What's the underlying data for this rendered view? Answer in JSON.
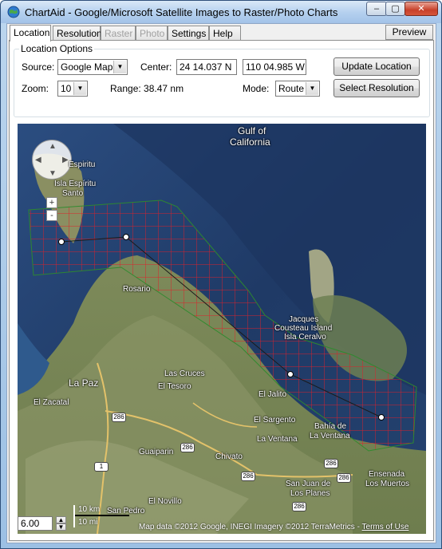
{
  "window": {
    "title": "ChartAid - Google/Microsoft Satellite Images to Raster/Photo Charts",
    "icon": "globe-icon",
    "controls": {
      "minimize": "‒",
      "maximize": "▢",
      "close": "✕"
    }
  },
  "tabs": [
    {
      "label": "Location",
      "state": "active"
    },
    {
      "label": "Resolution",
      "state": "normal"
    },
    {
      "label": "Raster",
      "state": "disabled"
    },
    {
      "label": "Photo",
      "state": "disabled"
    },
    {
      "label": "Settings",
      "state": "normal"
    },
    {
      "label": "Help",
      "state": "normal"
    }
  ],
  "preview_label": "Preview",
  "location_options": {
    "group_title": "Location Options",
    "source_label": "Source:",
    "source_value": "Google Maps",
    "center_label": "Center:",
    "center_lat": "24 14.037 N",
    "center_lon": "110 04.985 W",
    "update_button": "Update Location",
    "zoom_label": "Zoom:",
    "zoom_value": "10",
    "range_text": "Range: 38.47 nm",
    "mode_label": "Mode:",
    "mode_value": "Route",
    "select_resolution_button": "Select Resolution"
  },
  "map": {
    "places": {
      "gulf": "Gulf of",
      "california": "California",
      "espiritu": "Espiritu",
      "isla_espiritu": "Isla Espíritu",
      "santo": "Santo",
      "rosario": "Rosario",
      "jacques": "Jacques",
      "cousteau": "Cousteau Island",
      "isla_ceralvo": "Isla Ceralvo",
      "la_paz": "La Paz",
      "el_zacatal": "El Zacatal",
      "las_cruces": "Las Cruces",
      "el_tesoro": "El Tesoro",
      "el_jalito": "El Jalito",
      "el_sargento": "El Sargento",
      "la_ventana": "La Ventana",
      "bahia_de": "Bahía de",
      "la_ventana_bay": "La Ventana",
      "guaiparin": "Guaiparin",
      "chivato": "Chivato",
      "san_juan": "San Juan de",
      "los_planes": "Los Planes",
      "ensenada": "Ensenada",
      "los_muertos": "Los Muertos",
      "el_novillo": "El Novillo",
      "san_pedro": "San Pedro"
    },
    "road_shields": [
      "286",
      "286",
      "286",
      "286",
      "1",
      "286",
      "286"
    ],
    "scale_km": "10 km",
    "scale_mi": "10 mi",
    "attribution": "Map data ©2012 Google, INEGI Imagery ©2012 TerraMetrics -",
    "terms": "Terms of Use",
    "zoom_field": "6.00",
    "zoom_plus": "+",
    "zoom_minus": "-",
    "pan_arrows": {
      "up": "▲",
      "down": "▼",
      "left": "◀",
      "right": "▶"
    },
    "colors": {
      "grid": "#e0202a",
      "outline": "#2e8b2e",
      "route": "#1a1a1a"
    }
  }
}
